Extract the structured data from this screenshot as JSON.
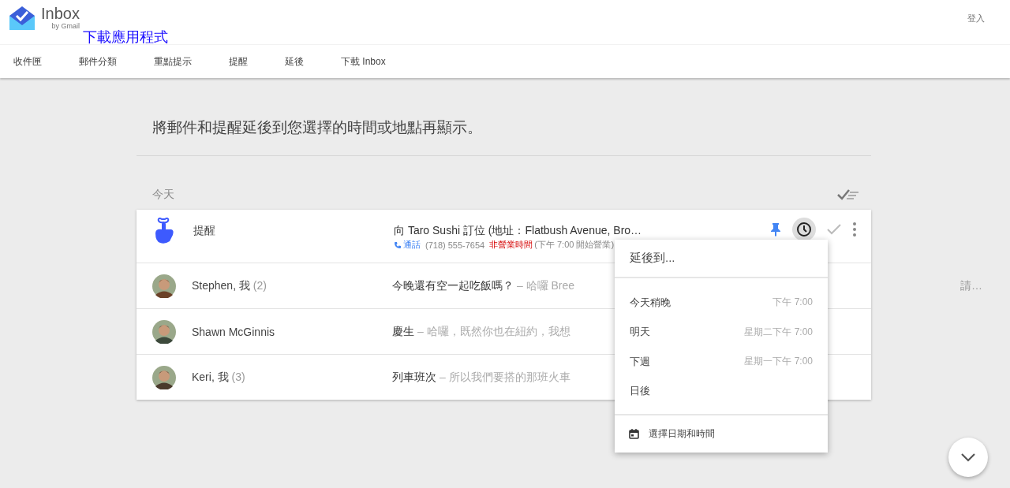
{
  "header": {
    "logo_title": "Inbox",
    "logo_subtitle": "by Gmail",
    "download_link": "下載應用程式",
    "sign_in": "登入"
  },
  "nav": [
    {
      "label": "收件匣",
      "selected": false
    },
    {
      "label": "郵件分類",
      "selected": false
    },
    {
      "label": "重點提示",
      "selected": false
    },
    {
      "label": "提醒",
      "selected": false
    },
    {
      "label": "延後",
      "selected": false
    },
    {
      "label": "下載 Inbox",
      "selected": false
    }
  ],
  "intro": "將郵件和提醒延後到您選擇的時間或地點再顯示。",
  "section": "今天",
  "items": [
    {
      "kind": "reminder",
      "sender": "提醒",
      "subject": "向 Taro Sushi 訂位 (地址：Flatbush Avenue, Bro…",
      "call": "通話",
      "phone": "(718) 555-7654",
      "status": "非營業時間",
      "hours": "(下午 7:00 開始營業)",
      "pinned": true
    },
    {
      "kind": "mail",
      "sender": "Stephen, 我",
      "count": "(2)",
      "subject": "今晚還有空一起吃飯嗎？",
      "snippet": "– 哈囉 Bree",
      "tail": "請…"
    },
    {
      "kind": "mail",
      "sender": "Shawn McGinnis",
      "subject": "慶生",
      "snippet": "– 哈囉，既然你也在紐約，我想"
    },
    {
      "kind": "mail",
      "sender": "Keri, 我",
      "count": "(3)",
      "subject": "列車班次",
      "snippet": "– 所以我們要搭的那班火車"
    }
  ],
  "snooze_menu": {
    "title": "延後到...",
    "options": [
      {
        "label": "今天稍晚",
        "time": "下午 7:00"
      },
      {
        "label": "明天",
        "time": "星期二下午 7:00"
      },
      {
        "label": "下週",
        "time": "星期一下午 7:00"
      },
      {
        "label": "日後"
      }
    ],
    "pick": "選擇日期和時間"
  }
}
